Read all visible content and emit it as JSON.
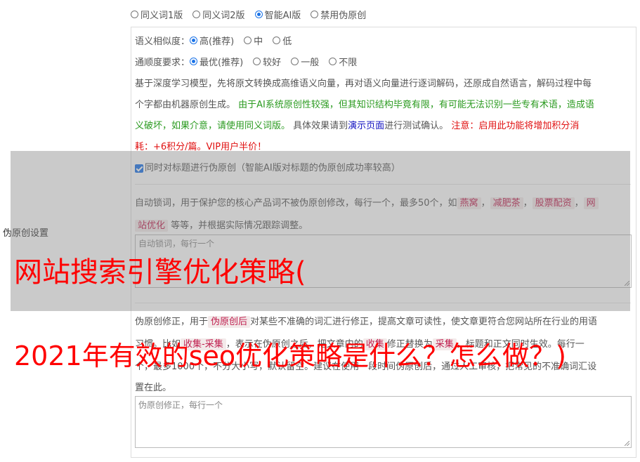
{
  "mode_options": [
    {
      "label": "同义词1版",
      "selected": false
    },
    {
      "label": "同义词2版",
      "selected": false
    },
    {
      "label": "智能AI版",
      "selected": true
    },
    {
      "label": "禁用伪原创",
      "selected": false
    }
  ],
  "similarity": {
    "label": "语义相似度：",
    "options": [
      {
        "label": "高(推荐)",
        "selected": true
      },
      {
        "label": "中",
        "selected": false
      },
      {
        "label": "低",
        "selected": false
      }
    ]
  },
  "fluency": {
    "label": "通顺度要求：",
    "options": [
      {
        "label": "最优(推荐)",
        "selected": true
      },
      {
        "label": "较好",
        "selected": false
      },
      {
        "label": "一般",
        "selected": false
      },
      {
        "label": "不限",
        "selected": false
      }
    ]
  },
  "desc": {
    "l1": "基于深度学习模型，先将原文转换成高维语义向量，再对语义向量进行逐词解码，还原成自然语言，解码过程中每",
    "l2a": "个字都由机器原创生成。 ",
    "l2b": "由于AI系统原创性较强，但其知识结构毕竟有限，有可能无法识别一些专有术语，造成语",
    "l3a": "义破坏，如果介意，请使用同义词版。",
    "l3b": " 具体效果请到",
    "l3c": "演示页面",
    "l3d": "进行测试确认。 ",
    "l3e": "注意：启用此功能将增加积分消",
    "l4": "耗：+6积分/篇。VIP用户半价！"
  },
  "title_checkbox": "同时对标题进行伪原创（智能AI版对标题的伪原创成功率较高）",
  "section_label": "伪原创设置",
  "lock": {
    "l1a": "自动锁词，用于保护您的核心产品词不被伪原创修改，每行一个，最多50个，如",
    "tag1": "燕窝",
    "tag2": "减肥茶",
    "tag3": "股票配资",
    "tag4a": "网",
    "tag4b": "站优化",
    "l2": " 等等，并根据实际情况跟踪调整。",
    "placeholder": "自动锁词，每行一个"
  },
  "correct": {
    "l1a": "伪原创修正，用于",
    "tag": "伪原创后",
    "l1b": "对某些不准确的词汇进行修正，提高文章可读性，使文章更符合您网站所在行业的用语",
    "l2a": "习惯。比如",
    "tag2": "收集-采集",
    "l2b": "，表示在伪原创之后，把文章内的",
    "tag3": "收集",
    "l2c": "修正替换为",
    "tag4": "采集",
    "l2d": "，标题和正文同时生效。每行一",
    "l3": "个，最多1000个，不分大小写，默认留空。建议在使用一段时间伪原创后，通过人工审核，把常见的不准确词汇设",
    "l4": "置在此。",
    "placeholder": "伪原创修正，每行一个"
  },
  "overlay_title_1": "网站搜索引擎优化策略(",
  "overlay_title_2": "2021年有效的seo优化策略是什么？怎么做？)"
}
